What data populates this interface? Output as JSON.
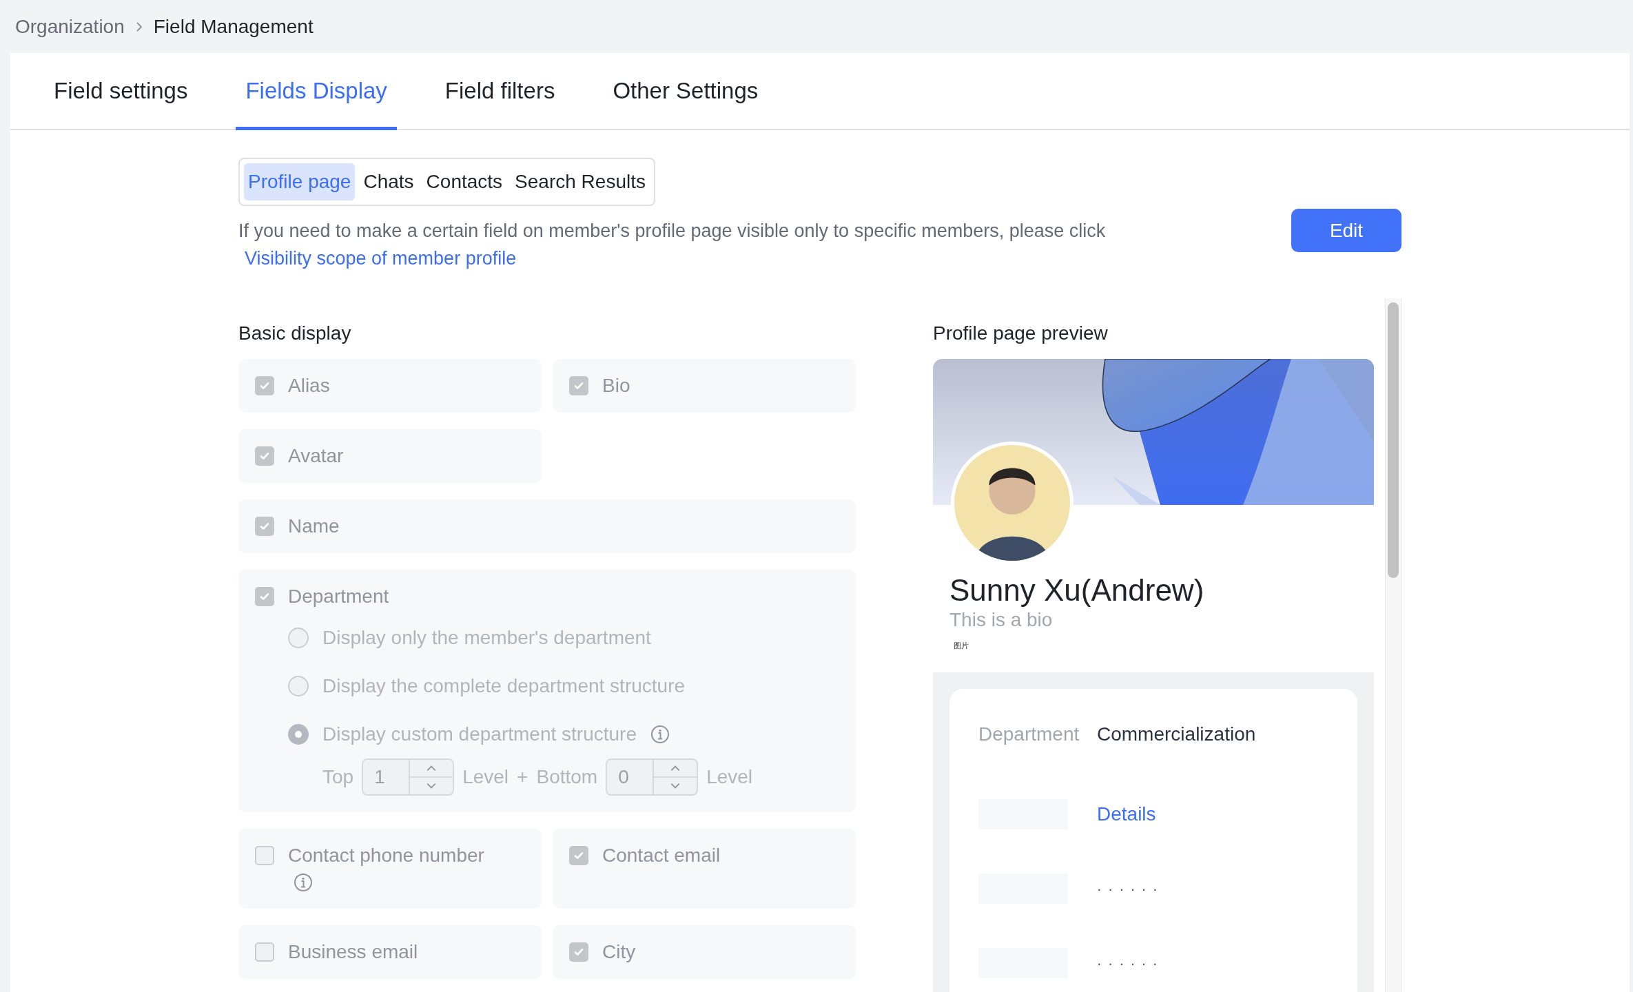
{
  "breadcrumb": [
    {
      "label": "Organization"
    },
    {
      "label": "Field Management"
    }
  ],
  "tabs": [
    {
      "label": "Field settings",
      "selected": false
    },
    {
      "label": "Fields Display",
      "selected": true
    },
    {
      "label": "Field filters",
      "selected": false
    },
    {
      "label": "Other Settings",
      "selected": false
    }
  ],
  "subtabs": [
    {
      "label": "Profile page",
      "selected": true
    },
    {
      "label": "Chats",
      "selected": false
    },
    {
      "label": "Contacts",
      "selected": false
    },
    {
      "label": "Search Results",
      "selected": false
    }
  ],
  "notice": {
    "text": "If you need to make a certain field on member's profile page visible only to specific members, please click",
    "link": "Visibility scope of member profile"
  },
  "edit_button": "Edit",
  "basic_display": {
    "title": "Basic display",
    "disabled": true,
    "rows": [
      [
        {
          "kind": "half",
          "label": "Alias",
          "checked": true
        },
        {
          "kind": "half",
          "label": "Bio",
          "checked": true
        }
      ],
      [
        {
          "kind": "half",
          "label": "Avatar",
          "checked": true
        }
      ],
      [
        {
          "kind": "full",
          "label": "Name",
          "checked": true
        }
      ],
      [
        {
          "kind": "full",
          "label": "Department",
          "checked": true,
          "options": [
            {
              "label": "Display only the member's department",
              "selected": false
            },
            {
              "label": "Display the complete department structure",
              "selected": false
            },
            {
              "label": "Display custom department structure",
              "selected": true,
              "info": true
            }
          ],
          "levels": {
            "top_label": "Top",
            "top_value": "1",
            "level_label": "Level",
            "plus": "+",
            "bottom_label": "Bottom",
            "bottom_value": "0",
            "level_label_2": "Level"
          }
        }
      ],
      [
        {
          "kind": "half",
          "label": "Contact phone number",
          "checked": false,
          "info": true
        },
        {
          "kind": "half",
          "label": "Contact email",
          "checked": true
        }
      ],
      [
        {
          "kind": "half",
          "label": "Business email",
          "checked": false
        },
        {
          "kind": "half",
          "label": "City",
          "checked": true
        }
      ]
    ]
  },
  "preview": {
    "title": "Profile page preview",
    "name": "Sunny Xu(Andrew)",
    "bio": "This is a bio",
    "caption": "图片",
    "details": [
      {
        "kind": "text",
        "label": "Department",
        "value": "Commercialization"
      },
      {
        "kind": "link",
        "value": "Details"
      },
      {
        "kind": "masked",
        "value": "· · · · · ·"
      },
      {
        "kind": "masked",
        "value": "· · · · · ·"
      }
    ]
  }
}
